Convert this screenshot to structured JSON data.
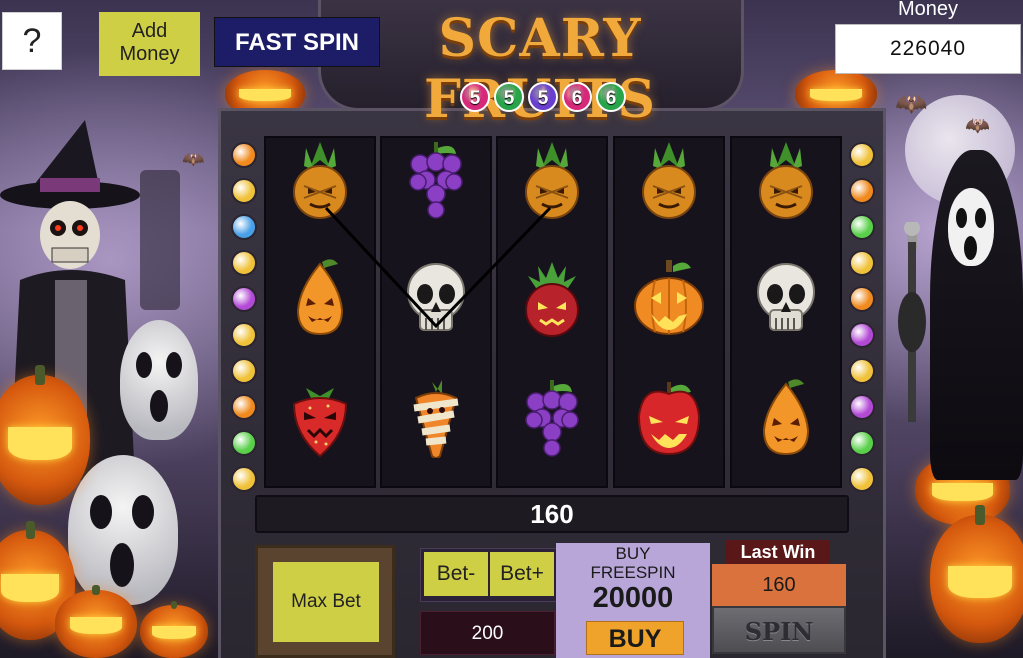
{
  "header": {
    "help_label": "?",
    "add_money_label": "Add Money",
    "fast_spin_label": "FAST SPIN",
    "game_title": "SCARY FRUITS",
    "title_balls": [
      {
        "n": "5",
        "color": "#d7297a"
      },
      {
        "n": "5",
        "color": "#28a44a"
      },
      {
        "n": "5",
        "color": "#6a3fcf"
      },
      {
        "n": "6",
        "color": "#d7297a"
      },
      {
        "n": "6",
        "color": "#28a44a"
      }
    ]
  },
  "wallet": {
    "label": "Money",
    "value": "226040"
  },
  "reels": [
    [
      "pineapple",
      "pumpkin-pear",
      "strawberry"
    ],
    [
      "grapes",
      "skull",
      "mummy-carrot"
    ],
    [
      "pineapple",
      "dragon-fruit",
      "grapes"
    ],
    [
      "pineapple",
      "jack-o-lantern",
      "apple"
    ],
    [
      "pineapple",
      "skull",
      "pumpkin-pear"
    ]
  ],
  "paylines": [
    [
      0,
      1,
      0
    ]
  ],
  "win_display": "160",
  "controls": {
    "max_bet_label": "Max Bet",
    "bet_minus_label": "Bet-",
    "bet_plus_label": "Bet+",
    "bet_value": "200",
    "freespin_line1": "BUY",
    "freespin_line2": "FREESPIN",
    "freespin_price": "20000",
    "buy_label": "BUY",
    "last_win_label": "Last Win",
    "last_win_value": "160",
    "spin_label": "SPIN"
  },
  "side_lights_left": [
    "#f08a1e",
    "#f0c23a",
    "#4aa0e8",
    "#f0c23a",
    "#b34ad6",
    "#f0c23a",
    "#f0c23a",
    "#f08a1e",
    "#5ad04a",
    "#f0c23a"
  ],
  "side_lights_right": [
    "#f0c23a",
    "#f08a1e",
    "#5ad04a",
    "#f0c23a",
    "#f08a1e",
    "#b34ad6",
    "#f0c23a",
    "#b34ad6",
    "#5ad04a",
    "#f0c23a"
  ]
}
